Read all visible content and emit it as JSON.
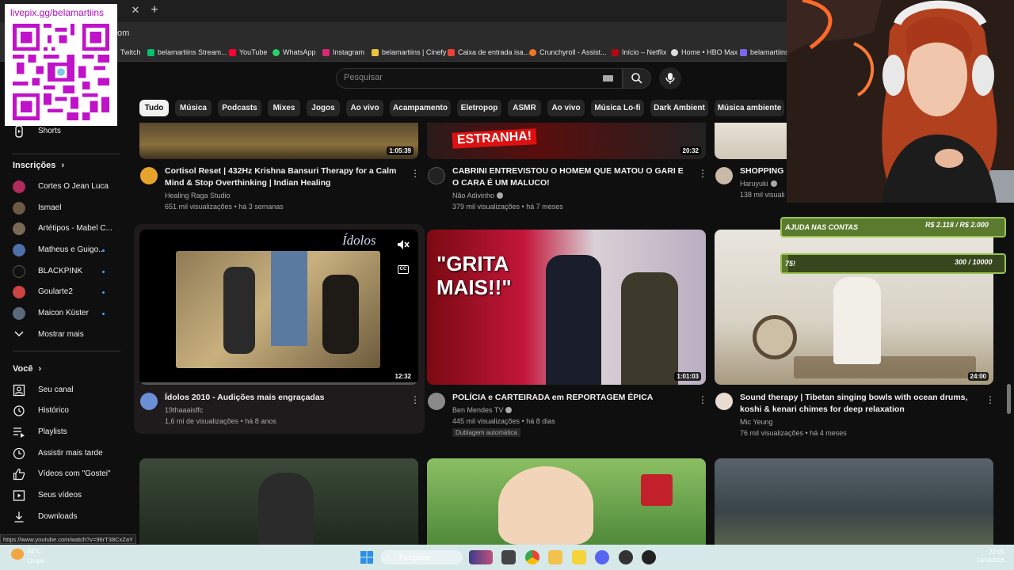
{
  "browser": {
    "url_tail": "om",
    "bookmarks": [
      "Twitch",
      "belamartiins Stream...",
      "YouTube",
      "WhatsApp",
      "Instagram",
      "belamartiins | Cinefy",
      "Caixa de entrada isa...",
      "Crunchyroll - Assist...",
      "Início – Netflix",
      "Home • HBO Max",
      "belamartiins"
    ],
    "status_url": "https://www.youtube.com/watch?v=96rT38CxZaY"
  },
  "overlay": {
    "qr_label": "livepix.gg/belamartiins",
    "goal1_left": "AJUDA NAS CONTAS",
    "goal1_right": "R$ 2.118 / R$ 2.000",
    "goal1_progress": 1.0,
    "goal2_left": "75!",
    "goal2_right": "300 / 10000",
    "goal2_progress": 0.03
  },
  "search": {
    "placeholder": "Pesquisar"
  },
  "chips": [
    "Tudo",
    "Música",
    "Podcasts",
    "Mixes",
    "Jogos",
    "Ao vivo",
    "Acampamento",
    "Eletropop",
    "ASMR",
    "Ao vivo",
    "Música Lo-fi",
    "Dark Ambient",
    "Música ambiente"
  ],
  "sidebar": {
    "shorts": "Shorts",
    "subs_header": "Inscrições",
    "subs": [
      "Cortes O Jean Luca",
      "Ismael",
      "Artétipos - Mabel C...",
      "Matheus e Guigo...",
      "BLACKPINK",
      "Goularte2",
      "Maicon Küster"
    ],
    "show_more": "Mostrar mais",
    "you_header": "Você",
    "you_items": [
      "Seu canal",
      "Histórico",
      "Playlists",
      "Assistir mais tarde",
      "Vídeos com \"Gostei\"",
      "Seus vídeos",
      "Downloads"
    ]
  },
  "videos": [
    {
      "title": "Cortisol Reset | 432Hz Krishna Bansuri Therapy for a Calm Mind & Stop Overthinking | Indian Healing",
      "channel": "Healing Raga Studio",
      "meta": "651 mil visualizações • há 3 semanas",
      "duration": "1:05:39"
    },
    {
      "title": "CABRINI ENTREVISTOU O HOMEM QUE MATOU O GARI E O CARA É UM MALUCO!",
      "channel": "Não Adivinho",
      "meta": "379 mil visualizações • há 7 meses",
      "duration": "20:32",
      "thumb_text": "ESTRANHA!"
    },
    {
      "title": "SHOPPING D",
      "channel": "Haruyuki",
      "meta": "138 mil visuali",
      "duration": ""
    },
    {
      "title": "Ídolos 2010 - Audições mais engraçadas",
      "channel": "19thaaaisffc",
      "meta": "1,6 mi de visualizações • há 8 anos",
      "duration": "12:32",
      "thumb_text": "Ídolos"
    },
    {
      "title": "POLÍCIA e CARTEIRADA em REPORTAGEM ÉPICA",
      "channel": "Ben Mendes TV",
      "meta": "445 mil visualizações • há 8 dias",
      "badge": "Dublagem automática",
      "duration": "1:01:03",
      "thumb_text": "\"GRITA MAIS!!\""
    },
    {
      "title": "Sound therapy | Tibetan singing bowls with ocean drums, koshi & kenari chimes for deep relaxation",
      "channel": "Mic Yeung",
      "meta": "76 mil visualizações • há 4 meses",
      "duration": "24:00"
    }
  ],
  "taskbar": {
    "weather_temp": "24°C",
    "weather_desc": "Limpo",
    "search": "Pesquisar",
    "time": "22:05",
    "date": "13/08/2025"
  }
}
